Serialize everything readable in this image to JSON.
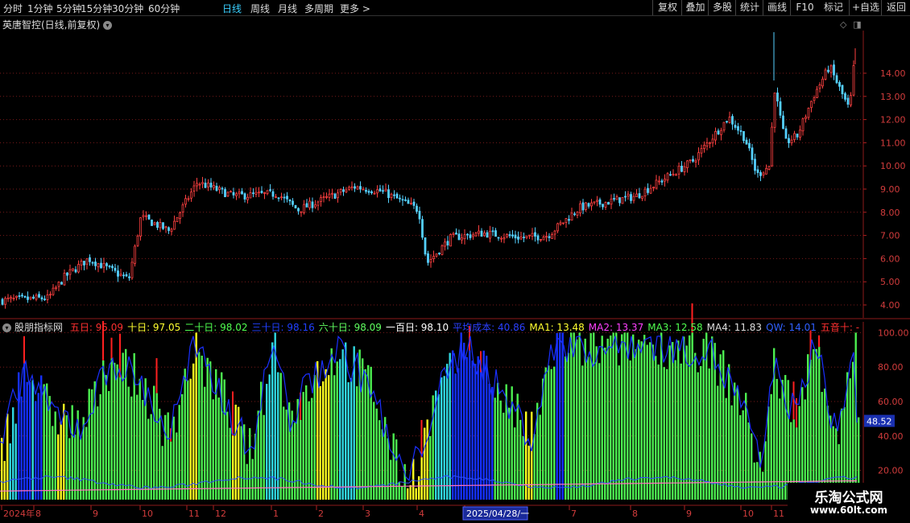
{
  "toolbar": {
    "periods": [
      "分时",
      "1分钟",
      "5分钟",
      "15分钟",
      "30分钟",
      "60分钟",
      "日线",
      "周线",
      "月线",
      "多周期",
      "更多"
    ],
    "active_period": "日线",
    "buttons": [
      "复权",
      "叠加",
      "多股",
      "统计",
      "画线",
      "F10",
      "+自选",
      "返回"
    ]
  },
  "main_chart": {
    "title": "英唐智控(日线,前复权)",
    "y_ticks": [
      "14.00",
      "13.00",
      "12.00",
      "11.00",
      "10.00",
      "9.00",
      "8.00",
      "7.00",
      "6.00",
      "5.00",
      "4.00"
    ]
  },
  "indicator": {
    "name": "股朋指标网",
    "items": [
      {
        "label": "五日: 95.09",
        "color": "#ff3030"
      },
      {
        "label": "十日: 97.05",
        "color": "#ffff30"
      },
      {
        "label": "二十日: 98.02",
        "color": "#50ff50"
      },
      {
        "label": "三十日: 98.16",
        "color": "#2040ff"
      },
      {
        "label": "六十日: 98.09",
        "color": "#60ff60"
      },
      {
        "label": "一百日: 98.10",
        "color": "#ffffff"
      },
      {
        "label": "平均成本: 40.86",
        "color": "#2a40ff"
      },
      {
        "label": "MA1: 13.48",
        "color": "#ffff30"
      },
      {
        "label": "MA2: 13.37",
        "color": "#ff40ff"
      },
      {
        "label": "MA3: 12.58",
        "color": "#50ff50"
      },
      {
        "label": "MA4: 11.83",
        "color": "#dddddd"
      },
      {
        "label": "QW: 14.01",
        "color": "#3060ff"
      },
      {
        "label": "五音十: -",
        "color": "#ff3030"
      }
    ],
    "y_ticks": [
      "100.00",
      "80.00",
      "60.00",
      "40.00",
      "20.00"
    ],
    "current_value": "48.52"
  },
  "x_axis": {
    "labels": [
      "2024年",
      "8",
      "9",
      "10",
      "11",
      "12",
      "1",
      "2",
      "3",
      "4",
      "2025/04/28/一",
      "7",
      "8",
      "9",
      "10",
      "11"
    ],
    "highlight": "2025/04/28/一"
  },
  "watermark": {
    "line1": "乐淘公式网",
    "line2": "www.60lt.com"
  }
}
